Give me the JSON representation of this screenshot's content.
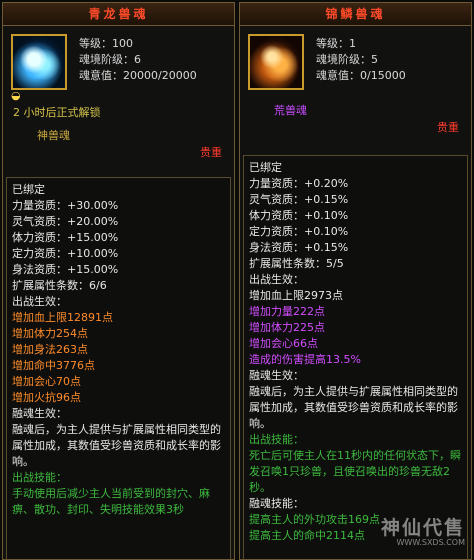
{
  "left": {
    "title": "青龙兽魂",
    "icon": "azure-dragon-soul-icon",
    "level": "等级：100",
    "realm": "魂境阶级：6",
    "will": "魂意值：20000/20000",
    "unlock": "2 小时后正式解锁",
    "soul_type": "神兽魂",
    "rarity": "贵重",
    "bound": "已绑定",
    "attrs": [
      "力量资质：+30.00%",
      "灵气资质：+20.00%",
      "体力资质：+15.00%",
      "定力资质：+10.00%",
      "身法资质：+15.00%",
      "扩展属性条数：6/6"
    ],
    "battle_label": "出战生效：",
    "bonuses": [
      "增加血上限12891点",
      "增加体力254点",
      "增加身法263点",
      "增加命中3776点",
      "增加会心70点",
      "增加火抗96点"
    ],
    "fusion_label": "融魂生效：",
    "fusion_text": "融魂后，为主人提供与扩展属性相同类型的属性加成，其数值受珍兽资质和成长率的影响。",
    "skill_label": "出战技能：",
    "skill_text": "手动使用后减少主人当前受到的封穴、麻痹、散功、封印、失明技能效果3秒"
  },
  "right": {
    "title": "锦鳞兽魂",
    "icon": "brocade-scale-soul-icon",
    "level": "等级：1",
    "realm": "魂境阶级：5",
    "will": "魂意值：0/15000",
    "soul_type": "荒兽魂",
    "rarity": "贵重",
    "bound": "已绑定",
    "attrs": [
      "力量资质：+0.20%",
      "灵气资质：+0.15%",
      "体力资质：+0.10%",
      "定力资质：+0.10%",
      "身法资质：+0.15%",
      "扩展属性条数：5/5"
    ],
    "battle_label": "出战生效：",
    "battle_first": "增加血上限2973点",
    "bonuses": [
      "增加力量222点",
      "增加体力225点",
      "增加会心66点",
      "造成的伤害提高13.5%"
    ],
    "fusion_label": "融魂生效：",
    "fusion_text": "融魂后，为主人提供与扩展属性相同类型的属性加成，其数值受珍兽资质和成长率的影响。",
    "skill_label": "出战技能：",
    "skill_text": "死亡后可使主人在11秒内的任何状态下，瞬发召唤1只珍兽，且使召唤出的珍兽无敌2秒。",
    "fusion_skill_label": "融魂技能：",
    "fusion_skills": [
      "提高主人的外功攻击169点",
      "提高主人的命中2114点"
    ]
  },
  "watermark": {
    "text": "神仙代售",
    "url": "WWW.SXDS.COM"
  }
}
